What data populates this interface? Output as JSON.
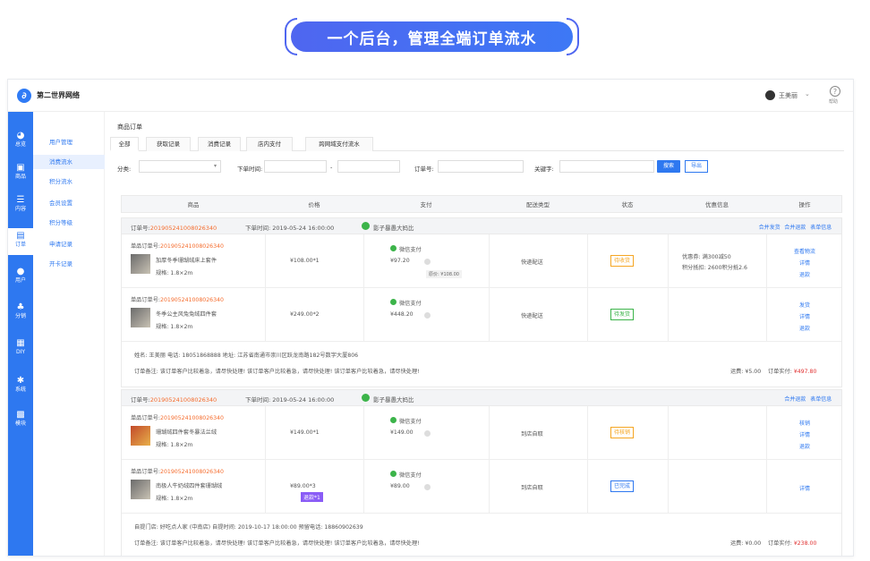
{
  "banner": {
    "title": "一个后台，管理全端订单流水"
  },
  "topbar": {
    "brand": "第二世界网络",
    "user": "王美丽",
    "help": "帮助"
  },
  "sidebar": {
    "items": [
      {
        "icon": "chart-pie-icon",
        "glyph": "◕",
        "label": "总览"
      },
      {
        "icon": "goods-icon",
        "glyph": "▣",
        "label": "商品"
      },
      {
        "icon": "content-icon",
        "glyph": "☰",
        "label": "内容"
      },
      {
        "icon": "order-icon",
        "glyph": "▤",
        "label": "订单"
      },
      {
        "icon": "user-icon",
        "glyph": "●",
        "label": "用户"
      },
      {
        "icon": "distribution-icon",
        "glyph": "♣",
        "label": "分销"
      },
      {
        "icon": "diy-icon",
        "glyph": "▦",
        "label": "DIY"
      },
      {
        "icon": "settings-icon",
        "glyph": "✱",
        "label": "系统"
      },
      {
        "icon": "module-icon",
        "glyph": "▩",
        "label": "模块"
      }
    ],
    "active_index": 3
  },
  "subnav": {
    "items": [
      "用户管理",
      "消费流水",
      "积分流水",
      "会员设置",
      "积分等级",
      "申请记录",
      "开卡记录"
    ],
    "active_index": 1
  },
  "content": {
    "breadcrumb": "商品订单",
    "tabs": [
      "全部",
      "获取记录",
      "消费记录",
      "店内支付",
      "跨网域支付流水"
    ],
    "active_tab": 0
  },
  "filters": {
    "category_label": "分类:",
    "category_value": "",
    "time_label": "下单时间:",
    "time_sep": "-",
    "order_label": "订单号:",
    "keyword_label": "关键字:",
    "search_btn": "搜索",
    "export_btn": "导出"
  },
  "table": {
    "headers": [
      "商品",
      "价格",
      "支付",
      "配送类型",
      "状态",
      "优惠信息",
      "操作"
    ]
  },
  "orders": [
    {
      "order_no_label": "订单号:",
      "order_no": "20190524100802634​0",
      "time": "下单时间: 2019-05-24 16:00:00",
      "shop": "影子暴愚大妈比",
      "header_links": [
        "合并发货",
        "合并退款",
        "表单信息"
      ],
      "items": [
        {
          "sub_label": "单品订单号:",
          "sub_no": "20190524100802634​0",
          "name": "加厚冬季珊瑚绒床上套件",
          "spec": "规格: 1.8×2m",
          "price": "¥108.00*1",
          "pay_method": "微信支付",
          "pay_amount": "¥97.20",
          "pay_tip": "原价: ¥108.00",
          "delivery": "快递配送",
          "status": "待收货",
          "status_color": "#f5a623",
          "promo": [
            "优惠券: 满300减50",
            "积分抵扣: 2600积分抵2.6"
          ],
          "actions": [
            "查看物流",
            "详情",
            "退款"
          ]
        },
        {
          "sub_label": "单品订单号:",
          "sub_no": "20190524100802634​0",
          "name": "冬季公主风兔兔绒四件套",
          "spec": "规格: 1.8×2m",
          "price": "¥249.00*2",
          "pay_method": "微信支付",
          "pay_amount": "¥448.20",
          "delivery": "快递配送",
          "status": "待发货",
          "status_color": "#3cb44a",
          "actions": [
            "发货",
            "详情",
            "退款"
          ]
        }
      ],
      "address": "姓名: 王美丽    电话: 18051868888    地址: 江苏省南通市崇川区跃龙南路182号数字大厦806",
      "remark": "订单备注: 该订单客户比较着急，请尽快处理! 该订单客户比较着急，请尽快处理! 该订单客户比较着急，请尽快处理!",
      "freight": "运费: ¥5.00",
      "paid_label": "订单实付:",
      "paid": "¥497.80"
    },
    {
      "order_no_label": "订单号:",
      "order_no": "20190524100802634​0",
      "time": "下单时间: 2019-05-24 16:00:00",
      "shop": "影子暴愚大妈比",
      "header_links": [
        "合并退款",
        "表单信息"
      ],
      "items": [
        {
          "sub_label": "单品订单号:",
          "sub_no": "20190524100802634​0",
          "name": "珊瑚绒四件套冬暴法兰绒",
          "spec": "规格: 1.8×2m",
          "price": "¥149.00*1",
          "pay_method": "微信支付",
          "pay_amount": "¥149.00",
          "delivery": "到店自取",
          "status": "待核销",
          "status_color": "#f5a623",
          "actions": [
            "核销",
            "详情",
            "退款"
          ]
        },
        {
          "sub_label": "单品订单号:",
          "sub_no": "20190524100802634​0",
          "name": "南极人牛奶绒四件套珊瑚绒",
          "spec": "规格: 1.8×2m",
          "price": "¥89.00*3",
          "refund_tag": "退款*1",
          "pay_method": "微信支付",
          "pay_amount": "¥89.00",
          "delivery": "到店自取",
          "status": "已完成",
          "status_color": "#2e78f0",
          "actions": [
            "详情"
          ]
        }
      ],
      "address": "自提门店: 好吃点人家 (中南店)    自提时间: 2019-10-17 18:00:00    预留电话: 18860902639",
      "remark": "订单备注: 该订单客户比较着急，请尽快处理! 该订单客户比较着急，请尽快处理! 该订单客户比较着急，请尽快处理!",
      "freight": "运费: ¥0.00",
      "paid_label": "订单实付:",
      "paid": "¥238.00"
    }
  ]
}
